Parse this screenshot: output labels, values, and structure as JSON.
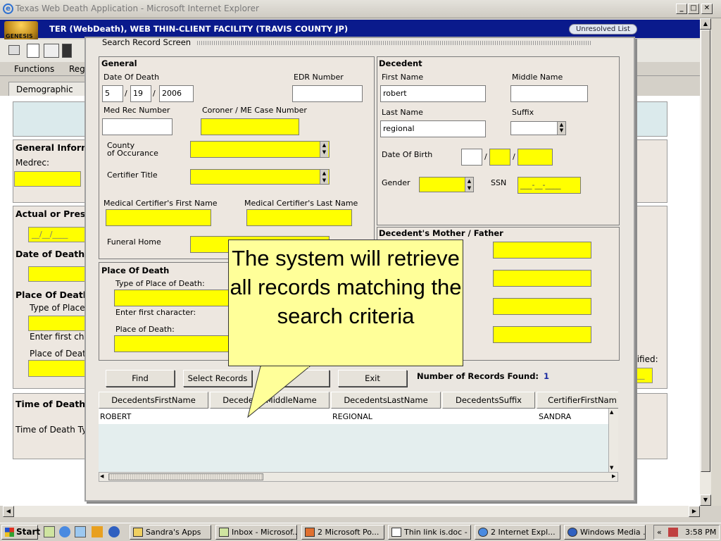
{
  "window": {
    "title": "Texas Web Death Application - Microsoft Internet Explorer",
    "min": "_",
    "max": "□",
    "close": "✕"
  },
  "app": {
    "logo": "GENESIS",
    "title": "TER (WebDeath), WEB THIN-CLIENT FACILITY (TRAVIS COUNTY JP)",
    "unresolved": "Unresolved List",
    "menu": [
      "Functions",
      "Reg"
    ],
    "tab": "Demographic 1"
  },
  "background": {
    "general_info": "General Inform",
    "medrec": "Medrec:",
    "actual": "Actual or Presu",
    "date_mask": "__/__/____",
    "date_of_death_t": "Date of Death T",
    "place_of_death": "Place Of Death",
    "type_of_place": "Type of Place",
    "enter_first_char": "Enter first cha",
    "place_of_death2": "Place of Death",
    "time_of_death": "Time of Death",
    "time_of_death_ty": "Time of Death Ty",
    "certified": "tified:",
    "certified_mask": "___"
  },
  "dialog": {
    "title": "Search Record Screen",
    "general": {
      "header": "General",
      "date_of_death_label": "Date Of Death",
      "dod_month": "5",
      "dod_day": "19",
      "dod_year": "2006",
      "slash": "/",
      "edr_label": "EDR Number",
      "medrec_label": "Med Rec Number",
      "coroner_label": "Coroner / ME Case Number",
      "county_label": "County\nof Occurance",
      "certifier_title_label": "Certifier Title",
      "cert_first_label": "Medical Certifier's First Name",
      "cert_last_label": "Medical Certifier's Last Name",
      "funeral_label": "Funeral Home"
    },
    "decedent": {
      "header": "Decedent",
      "first_name_label": "First Name",
      "first_name": "robert",
      "middle_name_label": "Middle Name",
      "last_name_label": "Last Name",
      "last_name": "regional",
      "suffix_label": "Suffix",
      "dob_label": "Date Of Birth",
      "gender_label": "Gender",
      "ssn_label": "SSN",
      "ssn_mask": "___-__-____"
    },
    "parents": {
      "header": "Decedent's Mother / Father"
    },
    "place": {
      "header": "Place Of Death",
      "type_label": "Type of Place of Death:",
      "enter_first": "Enter first character:",
      "place_label": "Place of Death:"
    },
    "buttons": {
      "find": "Find",
      "select": "Select Records",
      "exit": "Exit"
    },
    "records_found_label": "Number of Records Found:",
    "records_found": "1",
    "grid": {
      "columns": [
        "DecedentsFirstName",
        "DecedentsMiddleName",
        "DecedentsLastName",
        "DecedentsSuffix",
        "CertifierFirstNam"
      ],
      "rows": [
        {
          "first": "ROBERT",
          "last": "REGIONAL",
          "cert_first": "SANDRA"
        }
      ]
    }
  },
  "callout": {
    "text": "The system will retrieve all records matching the search criteria"
  },
  "taskbar": {
    "start": "Start",
    "tasks": [
      "Sandra's Apps",
      "Inbox - Microsof...",
      "2 Microsoft Po...",
      "Thin link is.doc - ...",
      "2 Internet Expl...",
      "Windows Media ..."
    ],
    "clock": "3:58 PM",
    "chevron": "«"
  },
  "colors": {
    "yellow": "#ffff00",
    "appbar": "#0a1a8c",
    "callout": "#ffff99"
  }
}
